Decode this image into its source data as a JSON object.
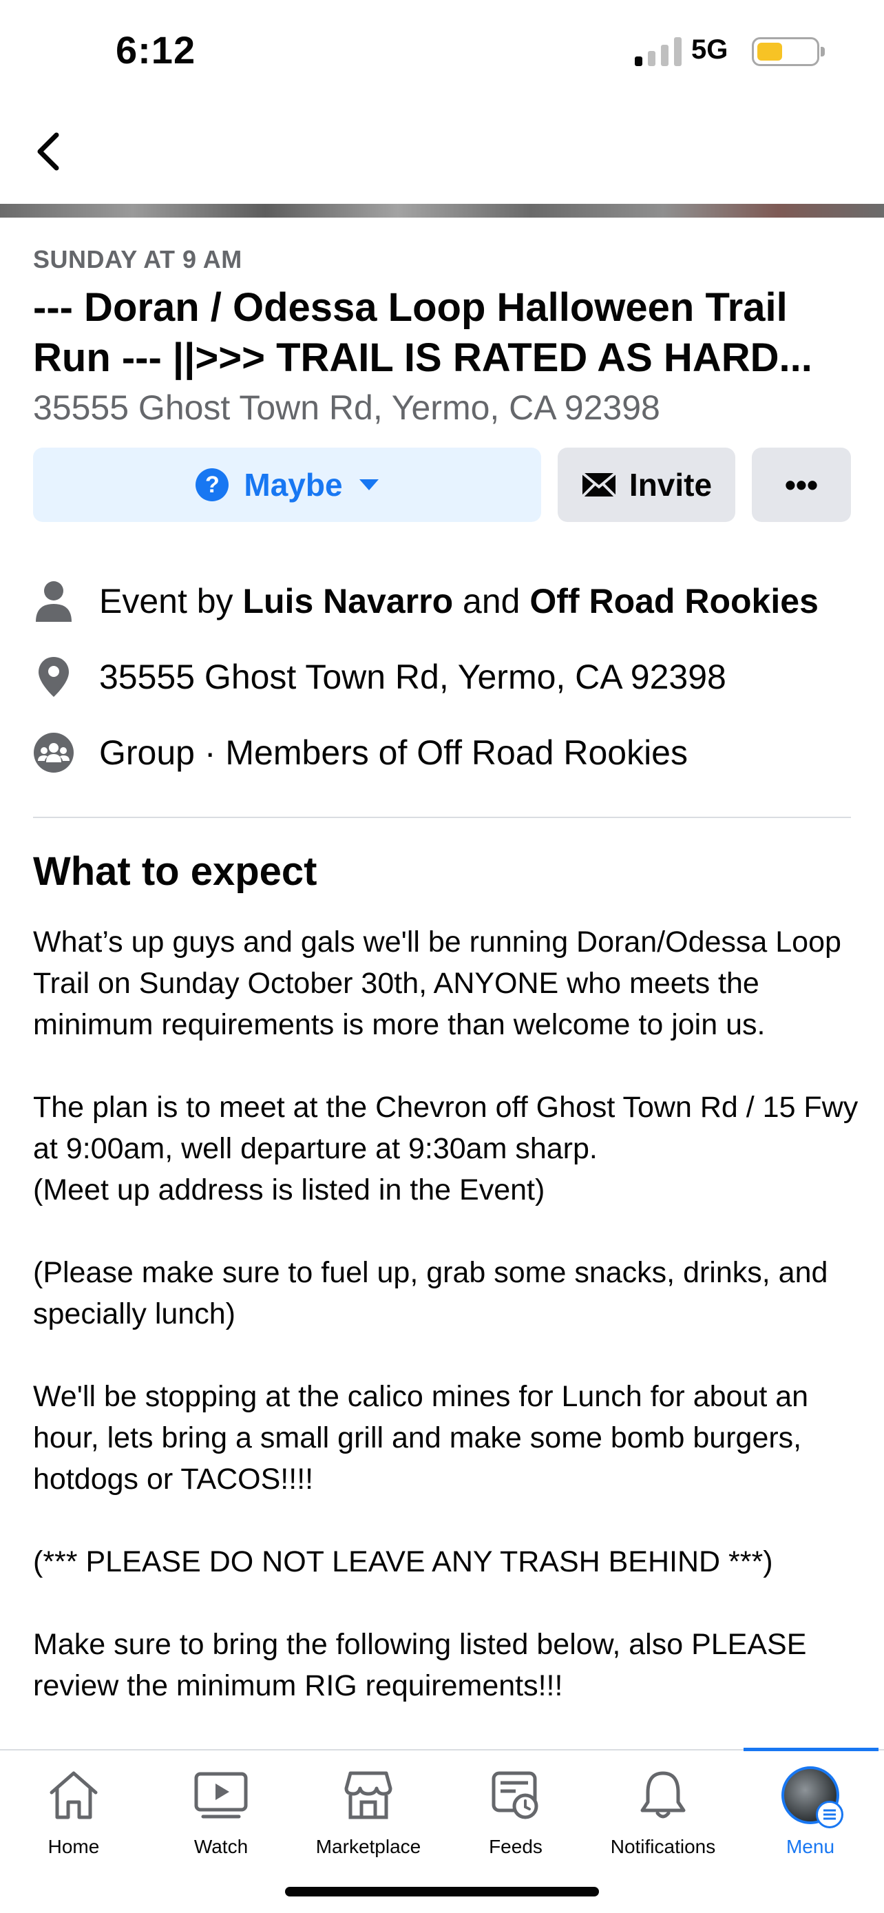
{
  "status_bar": {
    "time": "6:12",
    "network": "5G",
    "battery_color": "#f7c325"
  },
  "event": {
    "when": "SUNDAY AT 9 AM",
    "title": "--- Doran / Odessa Loop Halloween Trail Run --- ||>>> TRAIL IS RATED AS HARD...",
    "address": "35555 Ghost Town Rd, Yermo, CA 92398"
  },
  "actions": {
    "maybe_label": "Maybe",
    "invite_label": "Invite",
    "more_label": "•••"
  },
  "info": {
    "hosted_prefix": "Event by",
    "host_1": "Luis Navarro",
    "and": "and",
    "host_2": "Off Road Rookies",
    "location": "35555 Ghost Town Rd, Yermo, CA 92398",
    "privacy": "Group · Members of Off Road Rookies"
  },
  "details": {
    "title": "What to expect",
    "body": "What’s up guys and gals we'll be running Doran/Odessa Loop Trail  on Sunday October 30th, ANYONE who meets the minimum requirements is more than welcome to join us.\n\nThe plan is to meet at the Chevron off Ghost Town Rd / 15 Fwy at 9:00am, well departure at 9:30am sharp.\n(Meet up address is listed in the Event)\n\n(Please make sure to fuel up, grab some snacks, drinks, and specially lunch)\n\nWe'll be stopping at the calico mines for Lunch for about an hour, lets bring a small grill and make some bomb burgers, hotdogs or TACOS!!!!\n\n(*** PLEASE DO NOT LEAVE ANY TRASH BEHIND ***)\n\nMake sure to bring the following listed below, also PLEASE review the minimum RIG requirements!!!"
  },
  "tabbar": {
    "home": "Home",
    "watch": "Watch",
    "marketplace": "Marketplace",
    "feeds": "Feeds",
    "notifications": "Notifications",
    "menu": "Menu",
    "active": "menu",
    "accent_color": "#1877f2"
  }
}
